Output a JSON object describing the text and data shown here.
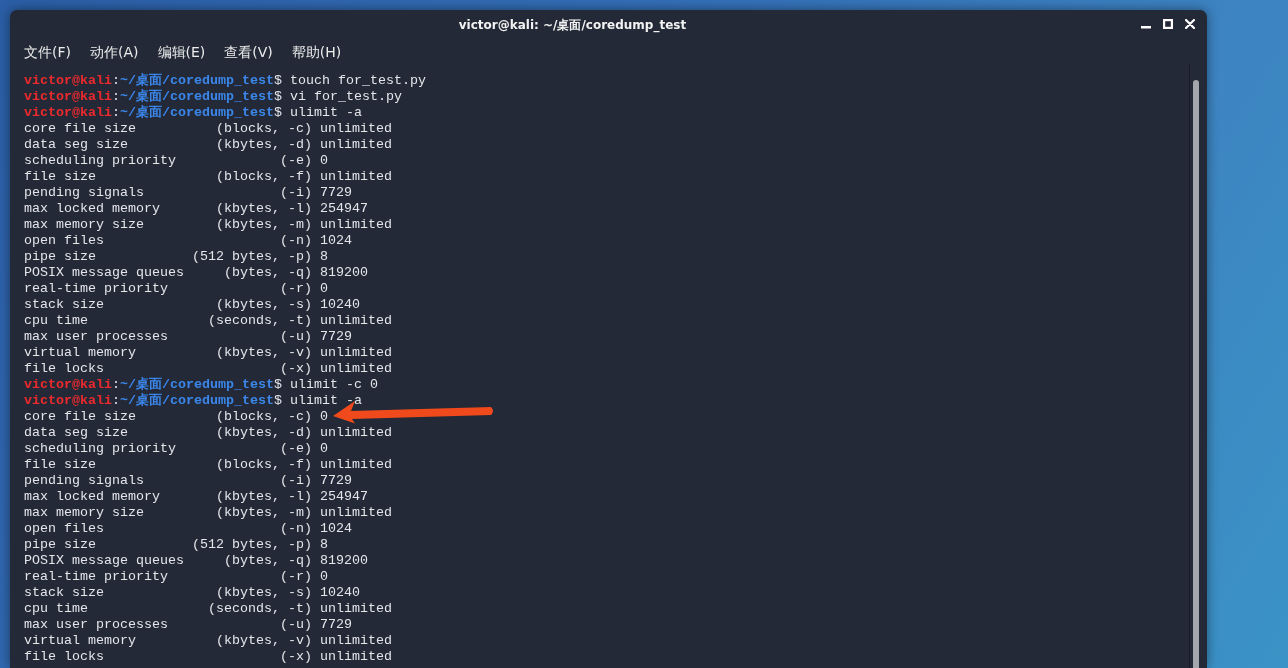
{
  "window": {
    "title": "victor@kali: ~/桌面/coredump_test"
  },
  "menu": [
    "文件(F)",
    "动作(A)",
    "编辑(E)",
    "查看(V)",
    "帮助(H)"
  ],
  "terminal": {
    "lines": [
      {
        "kind": "prompt",
        "user": "victor@kali",
        "separator": ":",
        "path": "~/桌面/coredump_test",
        "symbol": "$",
        "command": "touch for_test.py"
      },
      {
        "kind": "prompt",
        "user": "victor@kali",
        "separator": ":",
        "path": "~/桌面/coredump_test",
        "symbol": "$",
        "command": "vi for_test.py"
      },
      {
        "kind": "prompt",
        "user": "victor@kali",
        "separator": ":",
        "path": "~/桌面/coredump_test",
        "symbol": "$",
        "command": "ulimit -a"
      },
      {
        "kind": "output",
        "text": "core file size          (blocks, -c) unlimited"
      },
      {
        "kind": "output",
        "text": "data seg size           (kbytes, -d) unlimited"
      },
      {
        "kind": "output",
        "text": "scheduling priority             (-e) 0"
      },
      {
        "kind": "output",
        "text": "file size               (blocks, -f) unlimited"
      },
      {
        "kind": "output",
        "text": "pending signals                 (-i) 7729"
      },
      {
        "kind": "output",
        "text": "max locked memory       (kbytes, -l) 254947"
      },
      {
        "kind": "output",
        "text": "max memory size         (kbytes, -m) unlimited"
      },
      {
        "kind": "output",
        "text": "open files                      (-n) 1024"
      },
      {
        "kind": "output",
        "text": "pipe size            (512 bytes, -p) 8"
      },
      {
        "kind": "output",
        "text": "POSIX message queues     (bytes, -q) 819200"
      },
      {
        "kind": "output",
        "text": "real-time priority              (-r) 0"
      },
      {
        "kind": "output",
        "text": "stack size              (kbytes, -s) 10240"
      },
      {
        "kind": "output",
        "text": "cpu time               (seconds, -t) unlimited"
      },
      {
        "kind": "output",
        "text": "max user processes              (-u) 7729"
      },
      {
        "kind": "output",
        "text": "virtual memory          (kbytes, -v) unlimited"
      },
      {
        "kind": "output",
        "text": "file locks                      (-x) unlimited"
      },
      {
        "kind": "prompt",
        "user": "victor@kali",
        "separator": ":",
        "path": "~/桌面/coredump_test",
        "symbol": "$",
        "command": "ulimit -c 0"
      },
      {
        "kind": "prompt",
        "user": "victor@kali",
        "separator": ":",
        "path": "~/桌面/coredump_test",
        "symbol": "$",
        "command": "ulimit -a"
      },
      {
        "kind": "output",
        "text": "core file size          (blocks, -c) 0"
      },
      {
        "kind": "output",
        "text": "data seg size           (kbytes, -d) unlimited"
      },
      {
        "kind": "output",
        "text": "scheduling priority             (-e) 0"
      },
      {
        "kind": "output",
        "text": "file size               (blocks, -f) unlimited"
      },
      {
        "kind": "output",
        "text": "pending signals                 (-i) 7729"
      },
      {
        "kind": "output",
        "text": "max locked memory       (kbytes, -l) 254947"
      },
      {
        "kind": "output",
        "text": "max memory size         (kbytes, -m) unlimited"
      },
      {
        "kind": "output",
        "text": "open files                      (-n) 1024"
      },
      {
        "kind": "output",
        "text": "pipe size            (512 bytes, -p) 8"
      },
      {
        "kind": "output",
        "text": "POSIX message queues     (bytes, -q) 819200"
      },
      {
        "kind": "output",
        "text": "real-time priority              (-r) 0"
      },
      {
        "kind": "output",
        "text": "stack size              (kbytes, -s) 10240"
      },
      {
        "kind": "output",
        "text": "cpu time               (seconds, -t) unlimited"
      },
      {
        "kind": "output",
        "text": "max user processes              (-u) 7729"
      },
      {
        "kind": "output",
        "text": "virtual memory          (kbytes, -v) unlimited"
      },
      {
        "kind": "output",
        "text": "file locks                      (-x) unlimited"
      }
    ]
  }
}
